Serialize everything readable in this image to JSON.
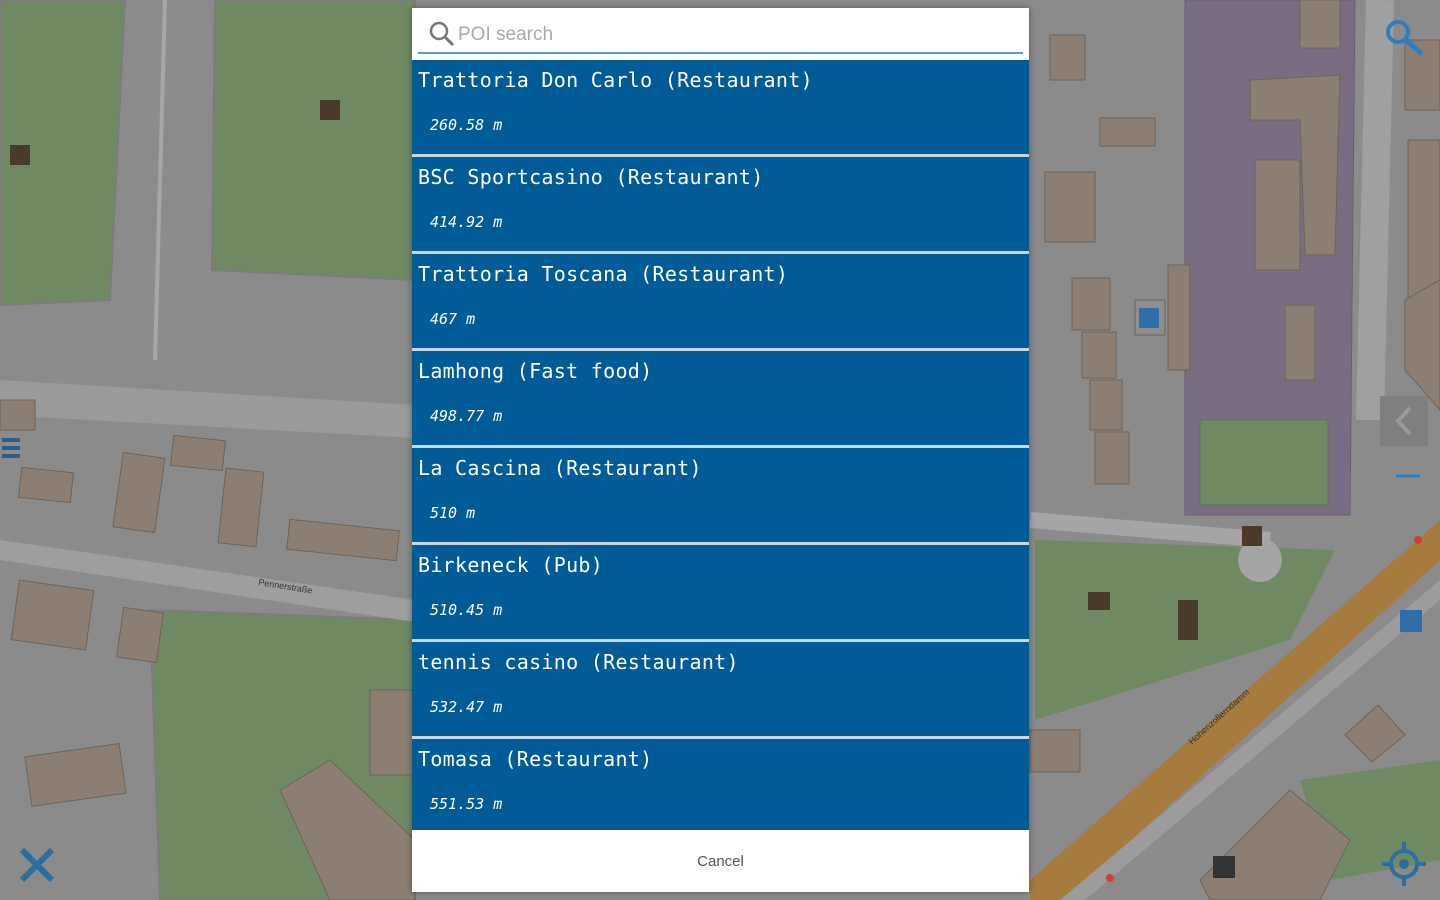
{
  "search": {
    "placeholder": "POI search"
  },
  "poi_results": [
    {
      "name": "Trattoria Don Carlo (Restaurant)",
      "distance": "260.58 m"
    },
    {
      "name": "BSC Sportcasino (Restaurant)",
      "distance": "414.92 m"
    },
    {
      "name": "Trattoria Toscana (Restaurant)",
      "distance": "467 m"
    },
    {
      "name": "Lamhong (Fast food)",
      "distance": "498.77 m"
    },
    {
      "name": "La Cascina (Restaurant)",
      "distance": "510 m"
    },
    {
      "name": "Birkeneck (Pub)",
      "distance": "510.45 m"
    },
    {
      "name": "tennis casino (Restaurant)",
      "distance": "532.47 m"
    },
    {
      "name": "Tomasa (Restaurant)",
      "distance": "551.53 m"
    }
  ],
  "dialog": {
    "cancel_label": "Cancel"
  },
  "map_labels": {
    "street1": "Pennerstraße",
    "street2": "Hohenzollerndamm"
  },
  "colors": {
    "list_item_bg": "#005b96",
    "search_underline": "#4aa0d8",
    "map_green": "#6f8a62",
    "map_building": "#8c7e72",
    "map_purple": "#7a6d83",
    "map_road_main": "#a57b3e"
  },
  "icons": {
    "search": "magnifier-icon",
    "zoom": "zoom-search-icon",
    "close": "close-x-icon",
    "locate": "gps-locate-icon",
    "layers": "layers-icon"
  }
}
